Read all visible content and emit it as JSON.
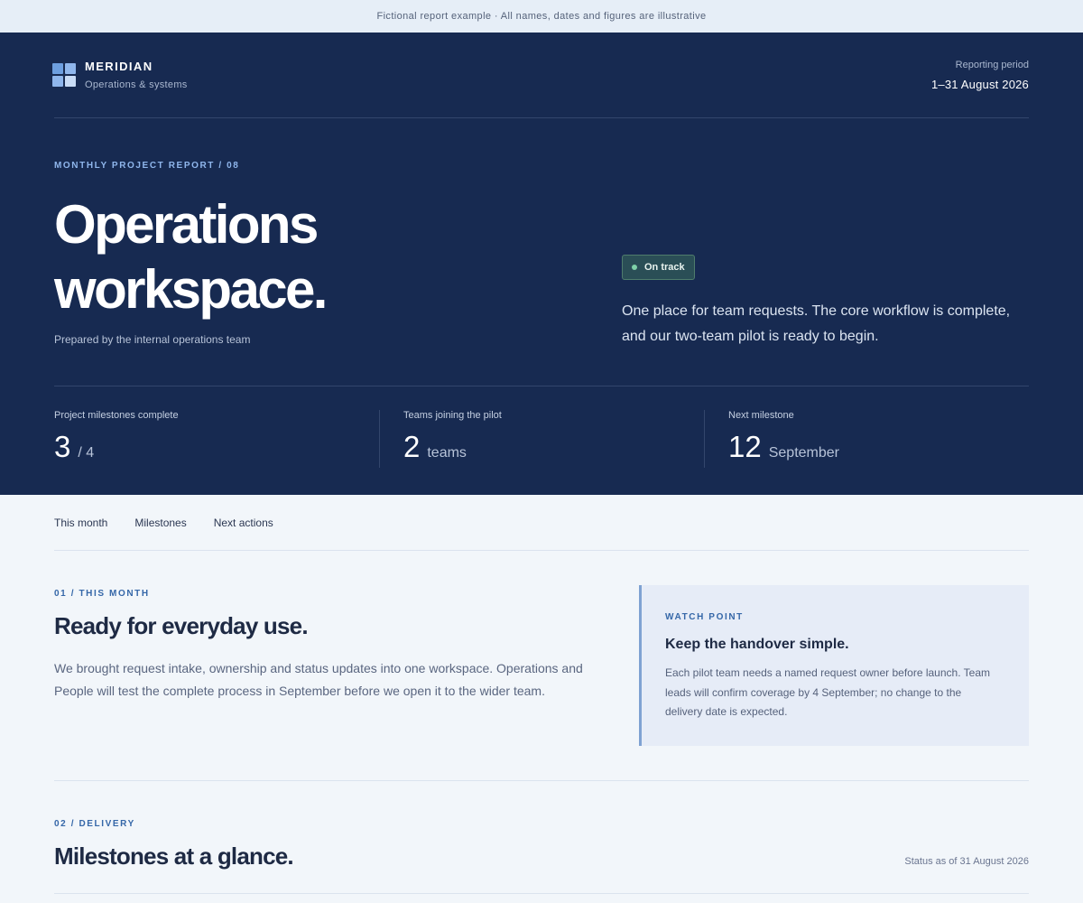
{
  "banner": {
    "text": "Fictional report example · All names, dates and figures are illustrative"
  },
  "header": {
    "brand_name": "MERIDIAN",
    "brand_sub": "Operations & systems",
    "period_label": "Reporting period",
    "period_value": "1–31 August 2026"
  },
  "hero": {
    "eyebrow": "MONTHLY PROJECT REPORT / 08",
    "title_line1": "Operations",
    "title_line2": "workspace.",
    "prepared": "Prepared by the internal operations team",
    "badge": "On track",
    "summary": "One place for team requests. The core workflow is complete, and our two-team pilot is ready to begin."
  },
  "stats": [
    {
      "label": "Project milestones complete",
      "value": "3",
      "unit": "/ 4"
    },
    {
      "label": "Teams joining the pilot",
      "value": "2",
      "unit": "teams"
    },
    {
      "label": "Next milestone",
      "value": "12",
      "unit": "September"
    }
  ],
  "subnav": [
    "This month",
    "Milestones",
    "Next actions"
  ],
  "section1": {
    "eyebrow": "01 / THIS MONTH",
    "title": "Ready for everyday use.",
    "body": "We brought request intake, ownership and status updates into one workspace. Operations and People will test the complete process in September before we open it to the wider team.",
    "callout": {
      "eyebrow": "WATCH POINT",
      "title": "Keep the handover simple.",
      "body": "Each pilot team needs a named request owner before launch. Team leads will confirm coverage by 4 September; no change to the delivery date is expected."
    }
  },
  "section2": {
    "eyebrow": "02 / DELIVERY",
    "title": "Milestones at a glance.",
    "status": "Status as of 31 August 2026"
  },
  "colors": {
    "hero_bg": "#172a51",
    "accent": "#3567a8",
    "badge_dot": "#7fd1a8",
    "page_bg": "#f2f6fa"
  }
}
